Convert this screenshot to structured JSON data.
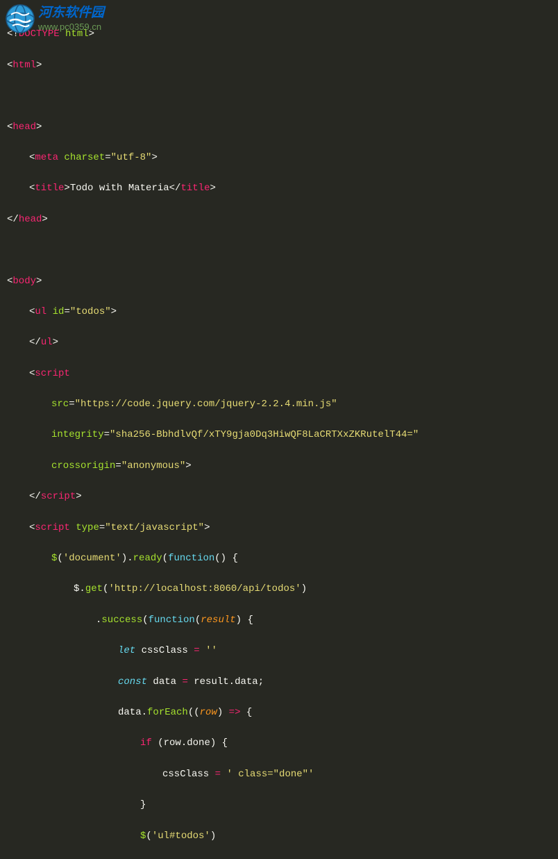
{
  "watermark": {
    "title": "河东软件园",
    "url": "www.pc0359.cn"
  },
  "code": {
    "l1_doctype": "DOCTYPE",
    "l1_html": "html",
    "l2_tag": "html",
    "l4_tag": "head",
    "l5_tag": "meta",
    "l5_attr": "charset",
    "l5_val": "\"utf-8\"",
    "l6_tag": "title",
    "l6_text": "Todo with Materia",
    "l7_tag": "head",
    "l9_tag": "body",
    "l10_tag": "ul",
    "l10_attr": "id",
    "l10_val": "\"todos\"",
    "l11_tag": "ul",
    "l12_tag": "script",
    "l13_attr": "src",
    "l13_val": "\"https://code.jquery.com/jquery-2.2.4.min.js\"",
    "l14_attr": "integrity",
    "l14_val": "\"sha256-BbhdlvQf/xTY9gja0Dq3HiwQF8LaCRTXxZKRutelT44=\"",
    "l15_attr": "crossorigin",
    "l15_val": "\"anonymous\"",
    "l16_tag": "script",
    "l17_tag": "script",
    "l17_attr": "type",
    "l17_val": "\"text/javascript\"",
    "l18_str": "'document'",
    "l18_ready": "ready",
    "l18_fn": "function",
    "l19_get": "get",
    "l19_url": "'http://localhost:8060/api/todos'",
    "l20_success": "success",
    "l20_fn": "function",
    "l20_param": "result",
    "l21_let": "let",
    "l21_var": "cssClass",
    "l21_val": "''",
    "l22_const": "const",
    "l22_var": "data",
    "l22_result": "result",
    "l22_data": "data",
    "l23_data": "data",
    "l23_foreach": "forEach",
    "l23_param": "row",
    "l24_if": "if",
    "l24_row": "row",
    "l24_done": "done",
    "l25_var": "cssClass",
    "l25_val": "' class=\"done\"'",
    "l27_str": "'ul#todos'"
  }
}
